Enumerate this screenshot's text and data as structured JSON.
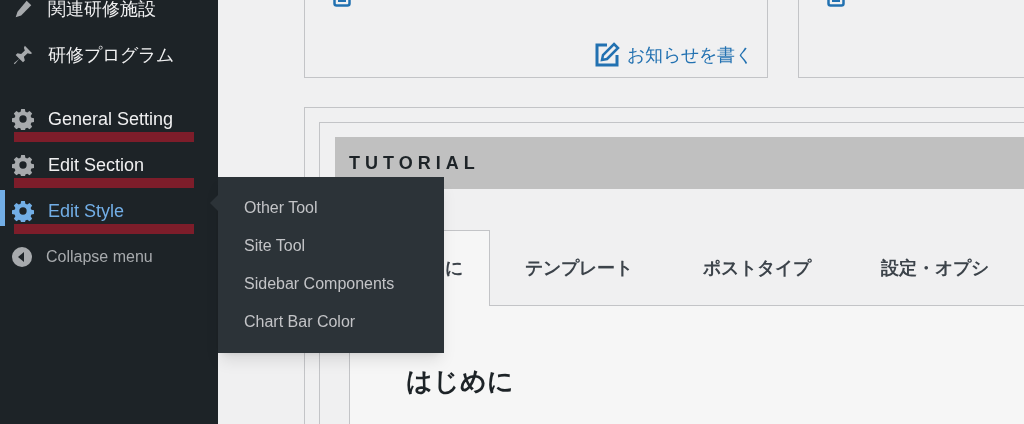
{
  "sidebar": {
    "items": [
      {
        "label": "関連研修施設",
        "kind": "pencil",
        "selected": false,
        "underlined": false
      },
      {
        "label": "研修プログラム",
        "kind": "pin",
        "selected": false,
        "underlined": false
      },
      {
        "label": "General Setting",
        "kind": "gear",
        "selected": false,
        "underlined": true
      },
      {
        "label": "Edit Section",
        "kind": "gear",
        "selected": false,
        "underlined": true
      },
      {
        "label": "Edit Style",
        "kind": "gear",
        "selected": true,
        "underlined": true
      },
      {
        "label": "Collapse menu",
        "kind": "collapse",
        "selected": false,
        "underlined": false
      }
    ],
    "flyout": [
      "Other Tool",
      "Site Tool",
      "Sidebar Components",
      "Chart Bar Color"
    ]
  },
  "write_link": "お知らせを書く",
  "tutorial": {
    "title": "TUTORIAL",
    "tabs": [
      {
        "label": "に",
        "selected": true
      },
      {
        "label": "テンプレート",
        "selected": false
      },
      {
        "label": "ポストタイプ",
        "selected": false
      },
      {
        "label": "設定・オプシ",
        "selected": false
      }
    ],
    "heading": "はじめに"
  }
}
